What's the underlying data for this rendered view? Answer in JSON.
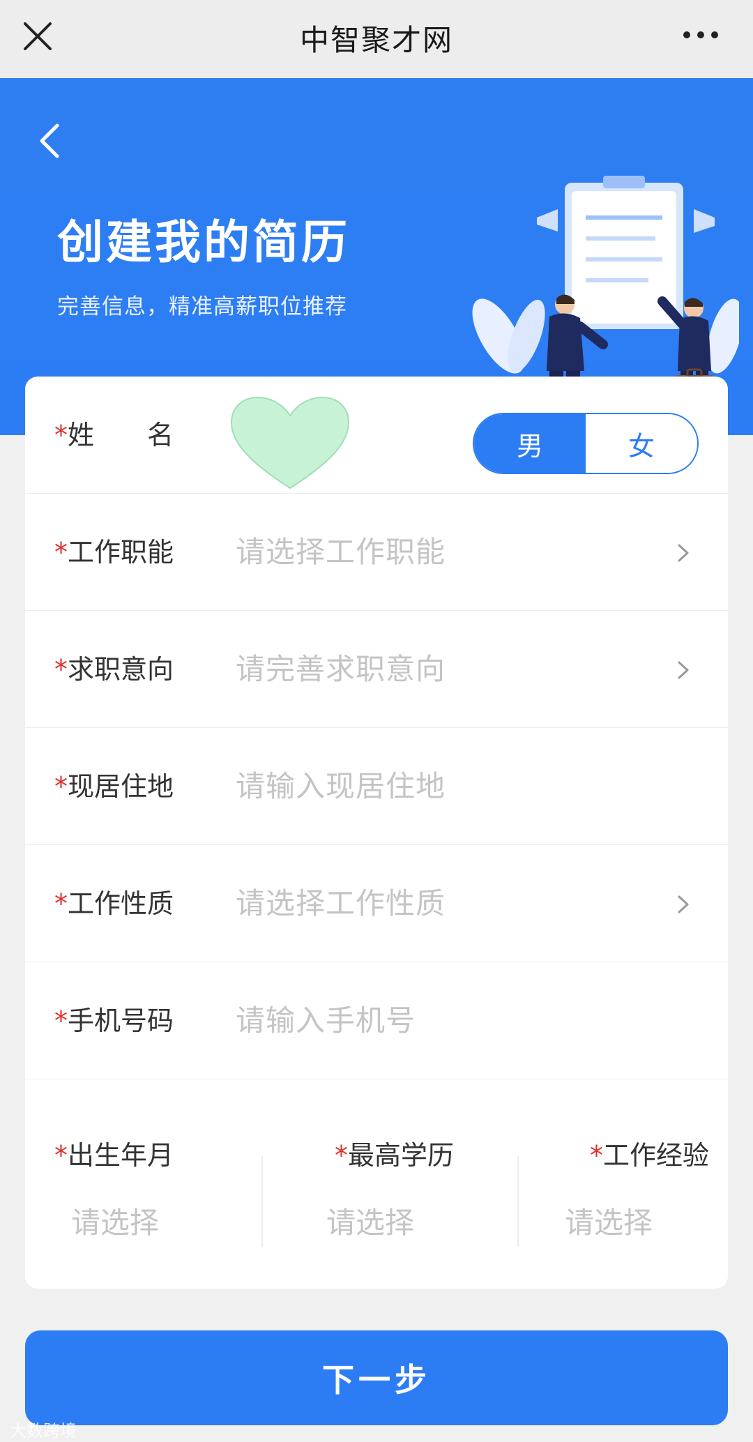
{
  "topbar": {
    "title": "中智聚才网"
  },
  "hero": {
    "heading": "创建我的简历",
    "subheading": "完善信息，精准高薪职位推荐"
  },
  "form": {
    "name": {
      "required_mark": "*",
      "label": "姓　　名"
    },
    "gender": {
      "male": "男",
      "female": "女",
      "selected": "男"
    },
    "rows": [
      {
        "required_mark": "*",
        "label": "工作职能",
        "placeholder": "请选择工作职能"
      },
      {
        "required_mark": "*",
        "label": "求职意向",
        "placeholder": "请完善求职意向"
      },
      {
        "required_mark": "*",
        "label": "现居住地",
        "placeholder": "请输入现居住地"
      },
      {
        "required_mark": "*",
        "label": "工作性质",
        "placeholder": "请选择工作性质"
      },
      {
        "required_mark": "*",
        "label": "手机号码",
        "placeholder": "请输入手机号"
      }
    ],
    "triple": [
      {
        "required_mark": "*",
        "label": "出生年月",
        "value": "请选择"
      },
      {
        "required_mark": "*",
        "label": "最高学历",
        "value": "请选择"
      },
      {
        "required_mark": "*",
        "label": "工作经验",
        "value": "请选择"
      }
    ]
  },
  "next_button": "下一步",
  "watermark": "大数跨境",
  "colors": {
    "accent": "#2c7cf4",
    "required": "#e0312c",
    "placeholder": "#c4c4c4"
  }
}
